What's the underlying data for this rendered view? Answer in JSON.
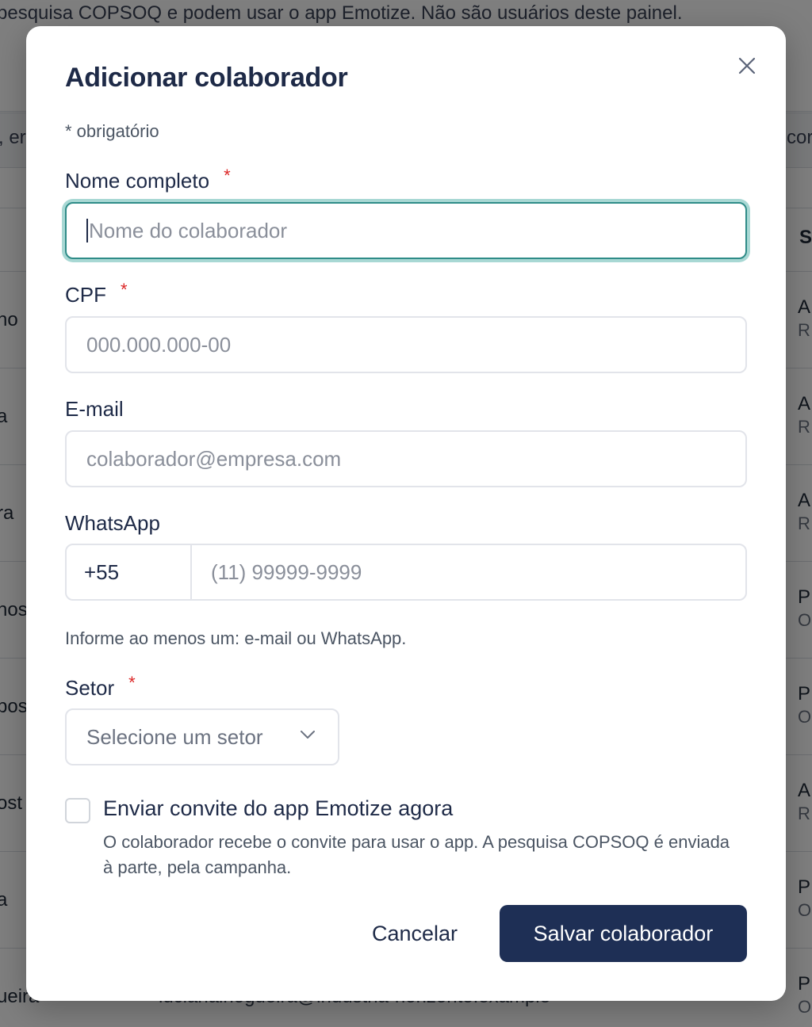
{
  "background": {
    "banner": "pesquisa COPSOQ e podem usar o app Emotize. Não são usuários deste painel.",
    "band_left": ", er",
    "band_right": "cor",
    "header_right": "S",
    "left_fragments": [
      "no",
      "a",
      "ra",
      "nos",
      "pos",
      "ost",
      "a",
      "ueira"
    ],
    "right_main": [
      "A",
      "A",
      "A",
      "P",
      "P",
      "A",
      "P",
      "P"
    ],
    "right_sub": [
      "R",
      "R",
      "R",
      "O",
      "O",
      "R",
      "O",
      "O"
    ],
    "bottom_email": "lucianainogueira@industria-horizonte.example"
  },
  "modal": {
    "title": "Adicionar colaborador",
    "required_note": "* obrigatório",
    "close_icon": "close-icon",
    "fields": {
      "name": {
        "label": "Nome completo",
        "required_mark": "*",
        "placeholder": "Nome do colaborador",
        "value": ""
      },
      "cpf": {
        "label": "CPF",
        "required_mark": "*",
        "placeholder": "000.000.000-00",
        "value": ""
      },
      "email": {
        "label": "E-mail",
        "placeholder": "colaborador@empresa.com",
        "value": ""
      },
      "whatsapp": {
        "label": "WhatsApp",
        "prefix": "+55",
        "placeholder": "(11) 99999-9999",
        "value": ""
      }
    },
    "hint": "Informe ao menos um: e-mail ou WhatsApp.",
    "sector": {
      "label": "Setor",
      "required_mark": "*",
      "placeholder": "Selecione um setor",
      "icon": "chevron-down-icon"
    },
    "invite": {
      "checked": false,
      "label": "Enviar convite do app Emotize agora",
      "description": "O colaborador recebe o convite para usar o app. A pesquisa COPSOQ é enviada à parte, pela campanha."
    },
    "buttons": {
      "cancel": "Cancelar",
      "save": "Salvar colaborador"
    }
  },
  "colors": {
    "accent": "#2f8c88",
    "primary_button": "#1e2f55",
    "required": "#dc2626",
    "text_dark": "#1e2a47"
  }
}
